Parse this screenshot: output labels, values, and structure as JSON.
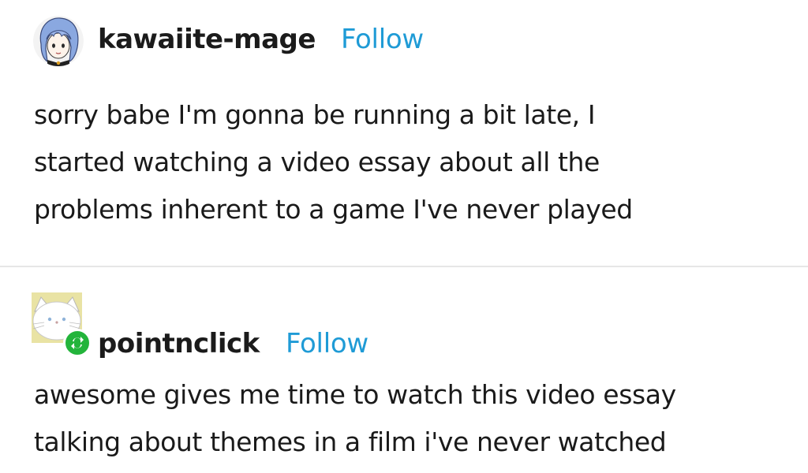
{
  "posts": [
    {
      "username": "kawaiite-mage",
      "follow_label": "Follow",
      "avatar_icon": "anime-avatar-blue-hair-icon",
      "lines": [
        "sorry babe I'm gonna be running a bit late, I",
        "started watching a video essay about all the",
        "problems inherent to a game I've never played"
      ]
    },
    {
      "username": "pointnclick",
      "follow_label": "Follow",
      "avatar_icon": "white-cat-avatar-icon",
      "badge_icon": "reblog-icon",
      "lines": [
        "awesome gives me time to watch this video essay",
        "talking about themes in a film i've never watched"
      ]
    }
  ],
  "colors": {
    "follow": "#1f9bd6",
    "reblog_badge": "#23b43b",
    "text": "#1a1a1a",
    "divider": "#e6e6e6"
  }
}
